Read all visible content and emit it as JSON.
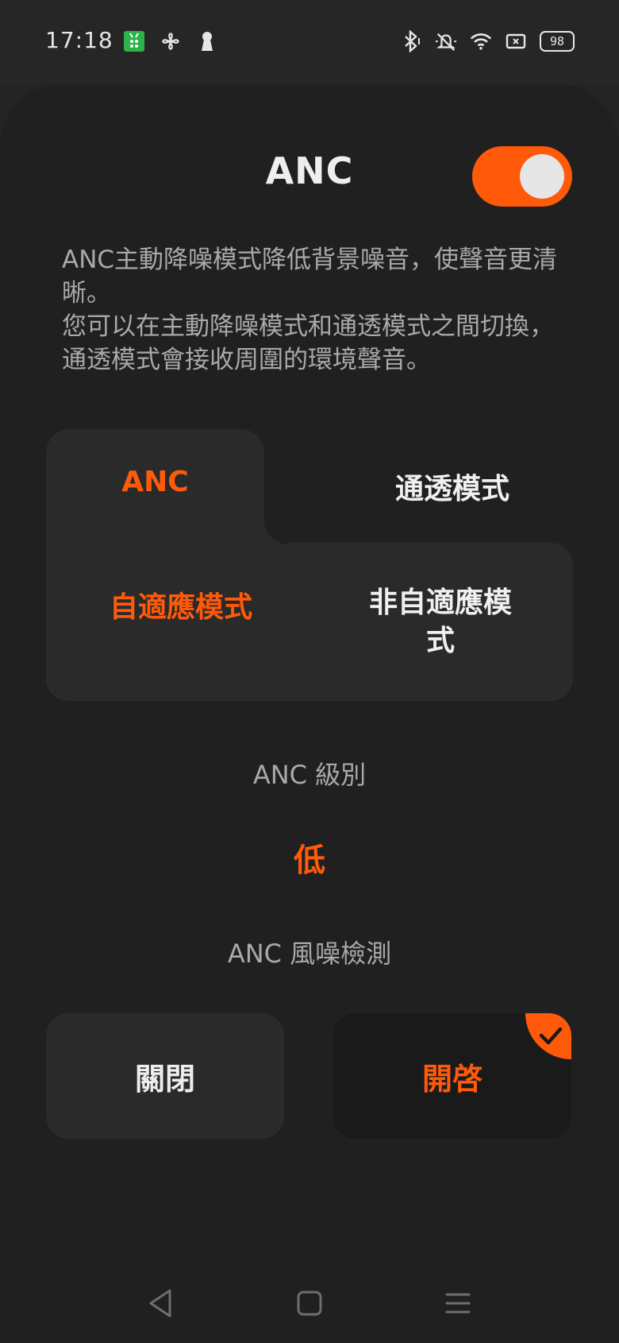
{
  "status_bar": {
    "time": "17:18",
    "battery": "98",
    "left_icons": [
      "app-store-icon",
      "fan-icon",
      "keyhole-icon"
    ],
    "right_icons": [
      "bluetooth-icon",
      "mute-icon",
      "wifi-icon",
      "sim-icon",
      "battery-icon"
    ]
  },
  "header": {
    "title": "ANC",
    "toggle_on": true
  },
  "description": {
    "line1": "ANC主動降噪模式降低背景噪音，使聲音更清晰。",
    "line2": "您可以在主動降噪模式和通透模式之間切換，通透模式會接收周圍的環境聲音。"
  },
  "tabs": [
    {
      "label": "ANC",
      "selected": true
    },
    {
      "label": "通透模式",
      "selected": false
    }
  ],
  "modes": [
    {
      "label": "自適應模式",
      "selected": true
    },
    {
      "label": "非自適應模式",
      "selected": false
    }
  ],
  "anc_level": {
    "label": "ANC 級別",
    "value": "低"
  },
  "wind_noise": {
    "label": "ANC 風噪檢測",
    "options": [
      {
        "label": "關閉",
        "selected": false
      },
      {
        "label": "開啓",
        "selected": true
      }
    ]
  },
  "colors": {
    "accent": "#ff5a0a",
    "background": "#202020",
    "card": "#2a2a2a"
  },
  "nav_bar": [
    "back-icon",
    "home-icon",
    "menu-icon"
  ]
}
